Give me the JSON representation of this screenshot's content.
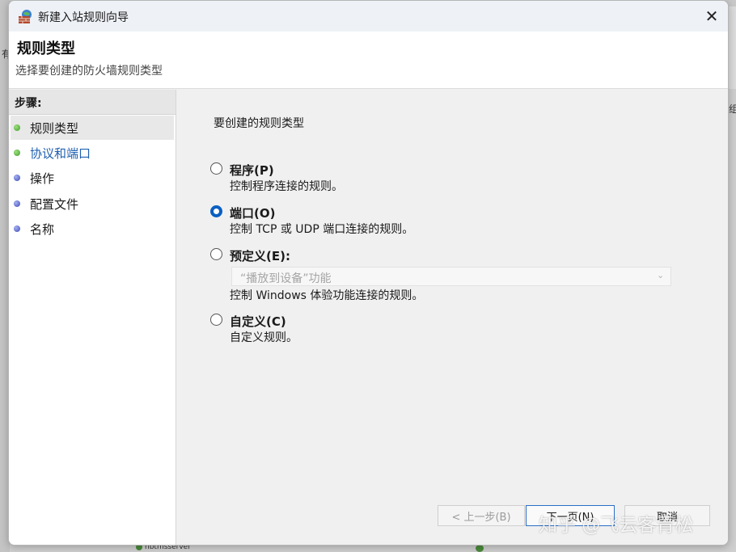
{
  "background": {
    "left_glyph": "有",
    "right_glyph": "组",
    "bottom_item": "nbtmsserver"
  },
  "titlebar": {
    "title": "新建入站规则向导",
    "close_glyph": "✕"
  },
  "header": {
    "title": "规则类型",
    "subtitle": "选择要创建的防火墙规则类型"
  },
  "steps": {
    "heading": "步骤:",
    "items": [
      {
        "label": "规则类型",
        "status": "complete"
      },
      {
        "label": "协议和端口",
        "status": "link"
      },
      {
        "label": "操作",
        "status": "pending"
      },
      {
        "label": "配置文件",
        "status": "pending"
      },
      {
        "label": "名称",
        "status": "pending"
      }
    ]
  },
  "main": {
    "question": "要创建的规则类型",
    "options": [
      {
        "label": "程序(P)",
        "description": "控制程序连接的规则。",
        "checked": false
      },
      {
        "label": "端口(O)",
        "description": "控制 TCP 或 UDP 端口连接的规则。",
        "checked": true
      },
      {
        "label": "预定义(E):",
        "description": "控制 Windows 体验功能连接的规则。",
        "checked": false
      },
      {
        "label": "自定义(C)",
        "description": "自定义规则。",
        "checked": false
      }
    ],
    "predefined_dropdown": {
      "value": "“播放到设备”功能",
      "disabled": true
    }
  },
  "buttons": {
    "back": "< 上一步(B)",
    "next": "下一页(N)",
    "cancel": "取消"
  },
  "watermark": "知乎 @飞云客青松",
  "colors": {
    "accent": "#0a5fc2",
    "link": "#1f5fb0",
    "complete_bullet": "#3f9b2a",
    "pending_bullet": "#3c47b0"
  }
}
